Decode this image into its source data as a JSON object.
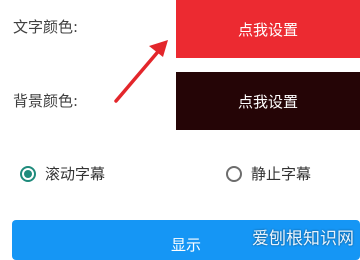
{
  "settings": {
    "text_color_label": "文字颜色:",
    "text_color_button": "点我设置",
    "bg_color_label": "背景颜色:",
    "bg_color_button": "点我设置"
  },
  "scroll_mode": {
    "option_scroll": "滚动字幕",
    "option_static": "静止字幕",
    "selected": "滚动字幕"
  },
  "actions": {
    "show_button": "显示"
  },
  "watermark": "爱刨根知识网",
  "colors": {
    "text_color_swatch": "#ec2a31",
    "bg_color_swatch": "#250506",
    "radio_accent": "#1f8b7c",
    "show_button": "#1596f5",
    "annotation_arrow": "#e3262b"
  },
  "icons": {
    "arrow": "annotation-arrow-icon"
  }
}
